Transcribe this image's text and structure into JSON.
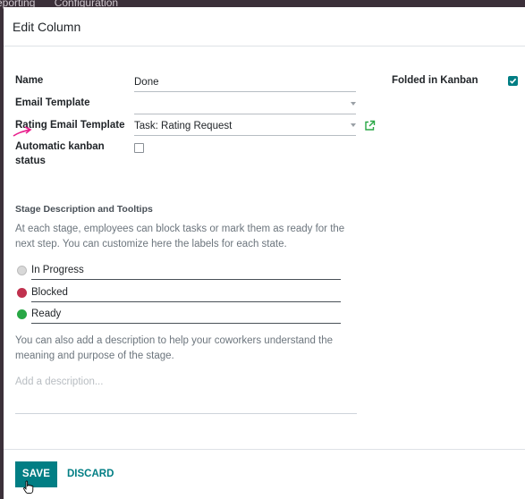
{
  "background": {
    "menu_items": [
      "eporting",
      "Configuration"
    ]
  },
  "dialog": {
    "title": "Edit Column",
    "fields": {
      "name": {
        "label": "Name",
        "value": "Done"
      },
      "email_template": {
        "label": "Email Template",
        "value": ""
      },
      "rating_email_template": {
        "label": "Rating Email Template",
        "value": "Task: Rating Request"
      },
      "automatic_kanban_status": {
        "label_line1": "Automatic kanban",
        "label_line2": "status",
        "checked": false
      },
      "folded_in_kanban": {
        "label": "Folded in Kanban",
        "checked": true
      }
    },
    "stage_section": {
      "title": "Stage Description and Tooltips",
      "help_line1": "At each stage, employees can block tasks or mark them as ready for the",
      "help_line2": "next step. You can customize here the labels for each state.",
      "states": [
        {
          "label": "In Progress",
          "color": "#d8d8d8"
        },
        {
          "label": "Blocked",
          "color": "#c0314e"
        },
        {
          "label": "Ready",
          "color": "#28a745"
        }
      ],
      "description_help_line1": "You can also add a description to help your coworkers understand the",
      "description_help_line2": "meaning and purpose of the stage.",
      "description_placeholder": "Add a description..."
    },
    "footer": {
      "save_label": "SAVE",
      "discard_label": "DISCARD"
    }
  },
  "colors": {
    "primary": "#017e84",
    "annotation_arrow": "#e91e8c"
  }
}
